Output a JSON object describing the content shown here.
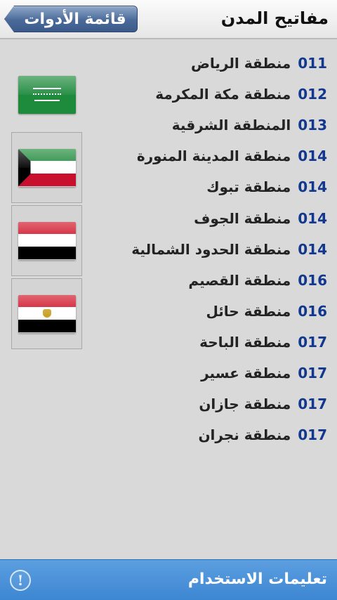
{
  "header": {
    "title": "مفاتيح المدن",
    "back_label": "قائمة الأدوات"
  },
  "regions": [
    {
      "code": "011",
      "name": "منطقة الرياض"
    },
    {
      "code": "012",
      "name": "منطقة مكة المكرمة"
    },
    {
      "code": "013",
      "name": "المنطقة الشرقية"
    },
    {
      "code": "014",
      "name": "منطقة المدينة المنورة"
    },
    {
      "code": "014",
      "name": "منطقة تبوك"
    },
    {
      "code": "014",
      "name": "منطقة الجوف"
    },
    {
      "code": "014",
      "name": "منطقة الحدود الشمالية"
    },
    {
      "code": "016",
      "name": "منطقة القصيم"
    },
    {
      "code": "016",
      "name": "منطقة حائل"
    },
    {
      "code": "017",
      "name": "منطقة الباحة"
    },
    {
      "code": "017",
      "name": "منطقة عسير"
    },
    {
      "code": "017",
      "name": "منطقة جازان"
    },
    {
      "code": "017",
      "name": "منطقة نجران"
    }
  ],
  "flags": [
    "saudi-arabia-flag-icon",
    "kuwait-flag-icon",
    "yemen-flag-icon",
    "egypt-flag-icon"
  ],
  "footer": {
    "label": "تعليمات الاستخدام",
    "info_glyph": "!"
  },
  "colors": {
    "code_text": "#12378f",
    "footer_bg": "#4a90d9",
    "back_button": "#4a6a9a"
  }
}
